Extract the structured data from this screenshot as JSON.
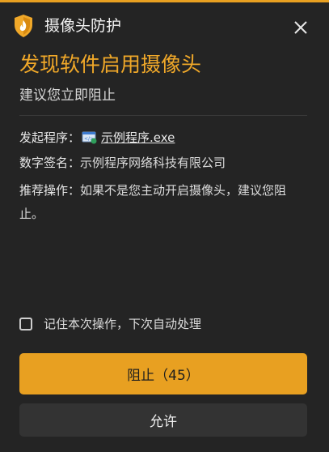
{
  "window": {
    "title": "摄像头防护"
  },
  "alert": {
    "headline": "发现软件启用摄像头",
    "subline": "建议您立即阻止"
  },
  "details": {
    "program_label": "发起程序：",
    "program_name": "示例程序.exe",
    "signature_label": "数字签名：",
    "signature_value": "示例程序网络科技有限公司",
    "advice_label": "推荐操作：",
    "advice_value": "如果不是您主动开启摄像头，建议您阻止。"
  },
  "remember": {
    "label": "记住本次操作，下次自动处理",
    "checked": false
  },
  "buttons": {
    "block_label": "阻止（45）",
    "allow_label": "允许"
  },
  "colors": {
    "accent": "#e8a021",
    "headline": "#f0a829",
    "background": "#242424"
  },
  "icons": {
    "app": "shield-icon",
    "close": "close-icon",
    "program": "exe-file-icon"
  }
}
